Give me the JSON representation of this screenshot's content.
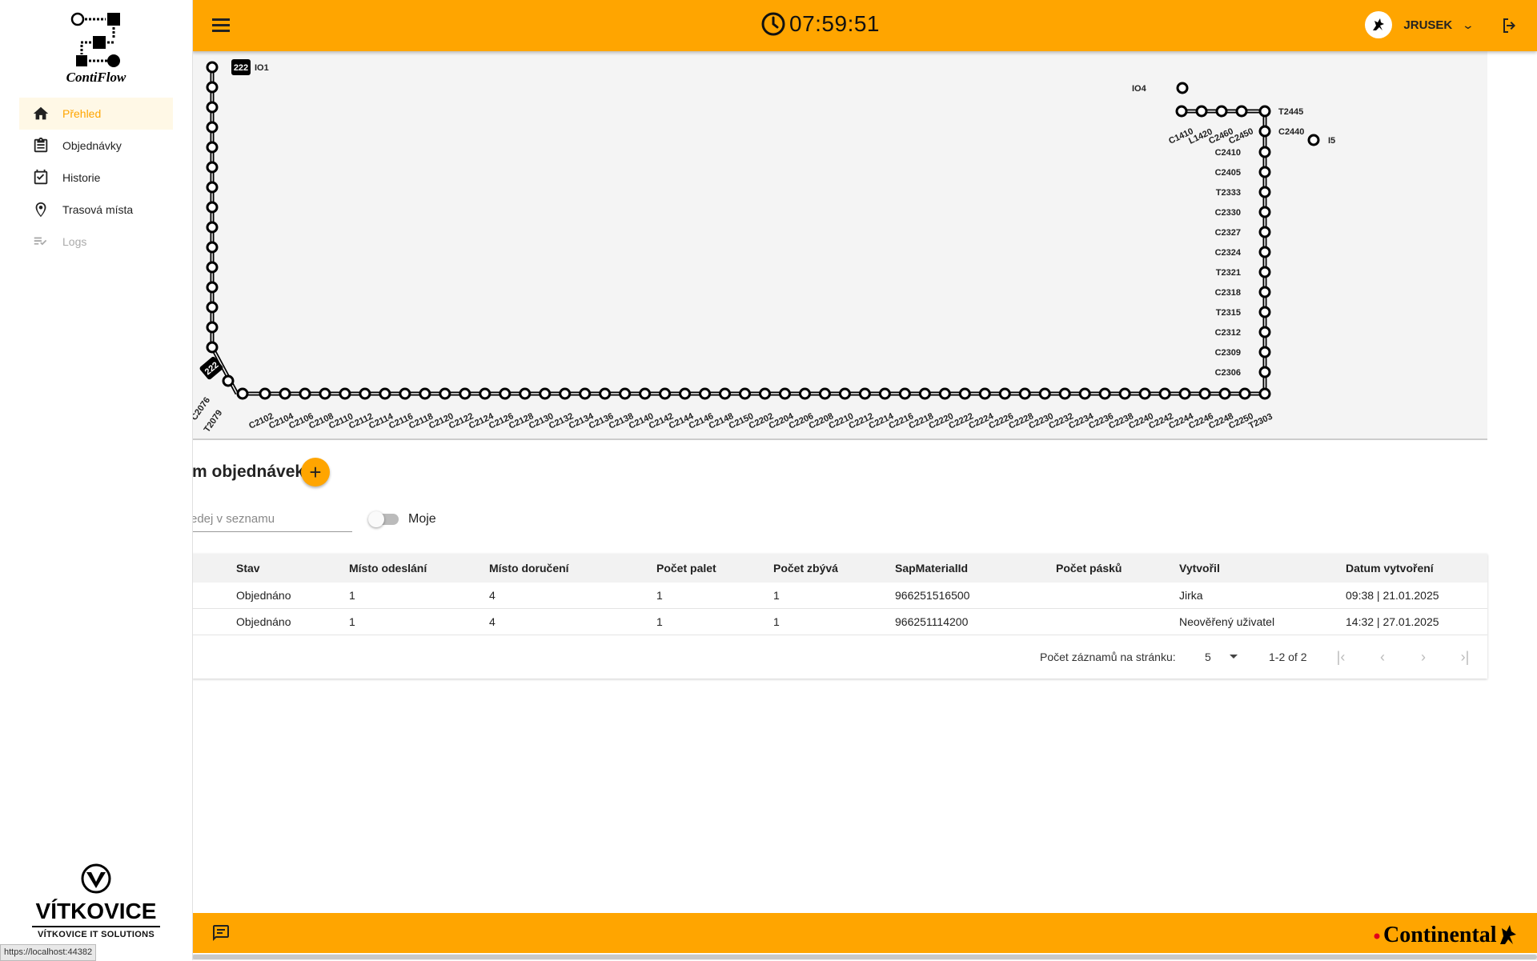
{
  "header": {
    "time": "07:59:51",
    "username": "JRUSEK"
  },
  "sidebar": {
    "logo_text": "ContiFlow",
    "items": [
      {
        "label": "Přehled",
        "icon": "home-icon",
        "active": true
      },
      {
        "label": "Objednávky",
        "icon": "clipboard-icon"
      },
      {
        "label": "Historie",
        "icon": "calendar-check-icon"
      },
      {
        "label": "Trasová místa",
        "icon": "location-pin-icon"
      },
      {
        "label": "Logs",
        "icon": "checklist-icon",
        "disabled": true
      }
    ],
    "company": "VÍTKOVICE",
    "company_sub": "VÍTKOVICE IT SOLUTIONS"
  },
  "map": {
    "left_top_badge": "222",
    "left_top_label": "IO1",
    "corner_badge": "222",
    "labels_left_bottom": [
      "3",
      "C2076",
      "T2079"
    ],
    "bottom_labels": [
      "C2102",
      "C2104",
      "C2106",
      "C2108",
      "C2110",
      "C2112",
      "C2114",
      "C2116",
      "C2118",
      "C2120",
      "C2122",
      "C2124",
      "C2126",
      "C2128",
      "C2130",
      "C2132",
      "C2134",
      "C2136",
      "C2138",
      "C2140",
      "C2142",
      "C2144",
      "C2146",
      "C2148",
      "C2150",
      "C2202",
      "C2204",
      "C2206",
      "C2208",
      "C2210",
      "C2212",
      "C2214",
      "C2216",
      "C2218",
      "C2220",
      "C2222",
      "C2224",
      "C2226",
      "C2228",
      "C2230",
      "C2232",
      "C2234",
      "C2236",
      "C2238",
      "C2240",
      "C2242",
      "C2244",
      "C2246",
      "C2248",
      "C2250",
      "T2303"
    ],
    "right_labels": [
      "C2410",
      "C2405",
      "T2333",
      "C2330",
      "C2327",
      "C2324",
      "T2321",
      "C2318",
      "T2315",
      "C2312",
      "C2309",
      "C2306"
    ],
    "top_right_labels": [
      "C1410",
      "L1420",
      "C2460",
      "C2450"
    ],
    "io4_label": "IO4",
    "t2445_label": "T2445",
    "c2440_label": "C2440",
    "i5_label": "I5"
  },
  "orders": {
    "title": "m objednávek",
    "search_placeholder": "edej v seznamu",
    "toggle_label": "Moje",
    "columns": [
      "Stav",
      "Místo odeslání",
      "Místo doručení",
      "Počet palet",
      "Počet zbývá",
      "SapMaterialId",
      "Počet pásků",
      "Vytvořil",
      "Datum vytvoření"
    ],
    "rows": [
      [
        "Objednáno",
        "1",
        "4",
        "1",
        "1",
        "966251516500",
        "",
        "Jirka",
        "09:38 | 21.01.2025"
      ],
      [
        "Objednáno",
        "1",
        "4",
        "1",
        "1",
        "966251114200",
        "",
        "Neověřený uživatel",
        "14:32 | 27.01.2025"
      ]
    ],
    "pager": {
      "label": "Počet záznamů na stránku:",
      "page_size": "5",
      "range": "1-2 of 2"
    }
  },
  "footer": {
    "brand": "Continental"
  },
  "status_url": "https://localhost:44382"
}
